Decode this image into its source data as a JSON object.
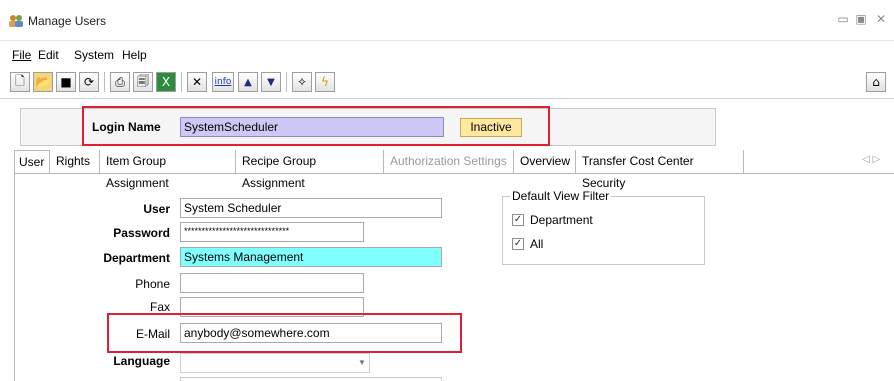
{
  "window": {
    "title": "Manage Users"
  },
  "menu": {
    "items": [
      "File",
      "Edit",
      "System",
      "Help"
    ],
    "underline": [
      "F",
      "E",
      "S",
      "H"
    ]
  },
  "toolbar": {
    "buttons": [
      "new-icon",
      "open-icon",
      "save-icon",
      "refresh-icon",
      "print-icon",
      "print-preview-icon",
      "export-excel-icon",
      "delete-icon",
      "info-icon",
      "up-arrow-icon",
      "down-arrow-icon",
      "wand-icon",
      "lightning-icon"
    ],
    "info_label": "info",
    "home": "home-icon"
  },
  "header": {
    "login_label": "Login Name",
    "login_value": "SystemScheduler",
    "status_badge": "Inactive"
  },
  "tabs": [
    {
      "label": "User",
      "state": "active"
    },
    {
      "label": "Rights",
      "state": "normal"
    },
    {
      "label": "Item Group Assignment",
      "state": "normal"
    },
    {
      "label": "Recipe Group Assignment",
      "state": "normal"
    },
    {
      "label": "Authorization Settings",
      "state": "disabled"
    },
    {
      "label": "Overview",
      "state": "normal"
    },
    {
      "label": "Transfer Cost Center Security",
      "state": "normal"
    }
  ],
  "form": {
    "user_label": "User",
    "user_value": "System Scheduler",
    "password_label": "Password",
    "password_value": "******************************",
    "department_label": "Department",
    "department_value": "Systems Management",
    "phone_label": "Phone",
    "phone_value": "",
    "fax_label": "Fax",
    "fax_value": "",
    "email_label": "E-Mail",
    "email_value": "anybody@somewhere.com",
    "language_label": "Language",
    "language_value": ""
  },
  "default_view_filter": {
    "title": "Default View Filter",
    "options": [
      {
        "label": "Department",
        "checked": true
      },
      {
        "label": "All",
        "checked": true
      }
    ]
  },
  "colors": {
    "highlight_box": "#e02030",
    "login_field": "#cdc8f5",
    "department_field": "#80ffff",
    "inactive_badge": "#ffe9a0"
  }
}
